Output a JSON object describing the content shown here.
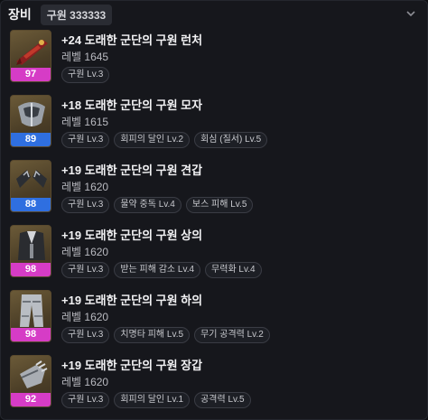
{
  "header": {
    "title": "장비",
    "badge": "구원 333333"
  },
  "colors": {
    "pink": "#d63cc6",
    "blue": "#2f6fe0"
  },
  "items": [
    {
      "name": "+24 도래한 군단의 구원 런처",
      "ilvl": "레벨 1645",
      "level": "97",
      "level_color": "pink",
      "icon": "launcher-icon",
      "tags": [
        "구원 Lv.3"
      ]
    },
    {
      "name": "+18 도래한 군단의 구원 모자",
      "ilvl": "레벨 1615",
      "level": "89",
      "level_color": "blue",
      "icon": "helmet-icon",
      "tags": [
        "구원 Lv.3",
        "회피의 달인 Lv.2",
        "회심 (질서) Lv.5"
      ]
    },
    {
      "name": "+19 도래한 군단의 구원 견갑",
      "ilvl": "레벨 1620",
      "level": "88",
      "level_color": "blue",
      "icon": "shoulder-icon",
      "tags": [
        "구원 Lv.3",
        "물약 중독 Lv.4",
        "보스 피해 Lv.5"
      ]
    },
    {
      "name": "+19 도래한 군단의 구원 상의",
      "ilvl": "레벨 1620",
      "level": "98",
      "level_color": "pink",
      "icon": "chest-icon",
      "tags": [
        "구원 Lv.3",
        "받는 피해 감소 Lv.4",
        "무력화 Lv.4"
      ]
    },
    {
      "name": "+19 도래한 군단의 구원 하의",
      "ilvl": "레벨 1620",
      "level": "98",
      "level_color": "pink",
      "icon": "pants-icon",
      "tags": [
        "구원 Lv.3",
        "치명타 피해 Lv.5",
        "무기 공격력 Lv.2"
      ]
    },
    {
      "name": "+19 도래한 군단의 구원 장갑",
      "ilvl": "레벨 1620",
      "level": "92",
      "level_color": "pink",
      "icon": "gloves-icon",
      "tags": [
        "구원 Lv.3",
        "회피의 달인 Lv.1",
        "공격력 Lv.5"
      ]
    }
  ]
}
